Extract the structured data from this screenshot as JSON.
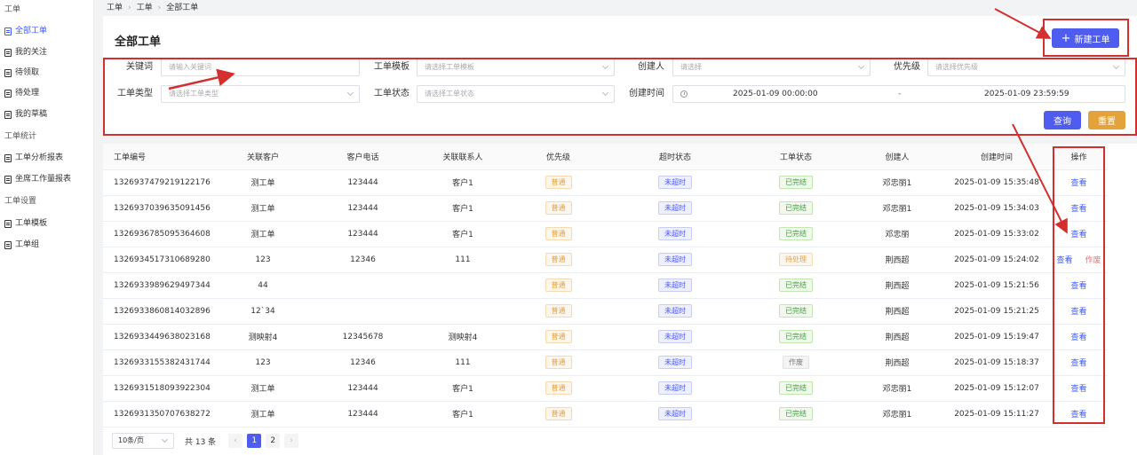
{
  "sidebar": {
    "group1": "工单",
    "items1": [
      "全部工单",
      "我的关注",
      "待领取",
      "待处理",
      "我的草稿"
    ],
    "group2": "工单统计",
    "items2": [
      "工单分析报表",
      "坐席工作量报表"
    ],
    "group3": "工单设置",
    "items3": [
      "工单模板",
      "工单组"
    ]
  },
  "breadcrumb": [
    "工单",
    "工单",
    "全部工单"
  ],
  "header": {
    "title": "全部工单",
    "new_button": "新建工单"
  },
  "filters": {
    "keyword_label": "关键词",
    "keyword_placeholder": "请输入关键词",
    "template_label": "工单模板",
    "template_placeholder": "请选择工单模板",
    "creator_label": "创建人",
    "creator_placeholder": "请选择",
    "priority_label": "优先级",
    "priority_placeholder": "请选择优先级",
    "type_label": "工单类型",
    "type_placeholder": "请选择工单类型",
    "status_label": "工单状态",
    "status_placeholder": "请选择工单状态",
    "created_label": "创建时间",
    "date_start": "2025-01-09 00:00:00",
    "date_sep": "-",
    "date_end": "2025-01-09 23:59:59",
    "query_button": "查询",
    "reset_button": "重置"
  },
  "table": {
    "headers": [
      "工单编号",
      "关联客户",
      "客户电话",
      "关联联系人",
      "优先级",
      "超时状态",
      "工单状态",
      "创建人",
      "创建时间",
      "操作"
    ],
    "rows": [
      {
        "id": "1326937479219122176",
        "customer": "测工单",
        "phone": "123444",
        "contact": "客户1",
        "priority": "普通",
        "timeout": "未超时",
        "status": "已完结",
        "creator": "邓忠丽1",
        "time": "2025-01-09 15:35:48",
        "action": "查看",
        "action2": ""
      },
      {
        "id": "1326937039635091456",
        "customer": "测工单",
        "phone": "123444",
        "contact": "客户1",
        "priority": "普通",
        "timeout": "未超时",
        "status": "已完结",
        "creator": "邓忠丽1",
        "time": "2025-01-09 15:34:03",
        "action": "查看",
        "action2": ""
      },
      {
        "id": "1326936785095364608",
        "customer": "测工单",
        "phone": "123444",
        "contact": "客户1",
        "priority": "普通",
        "timeout": "未超时",
        "status": "已完结",
        "creator": "邓忠丽",
        "time": "2025-01-09 15:33:02",
        "action": "查看",
        "action2": ""
      },
      {
        "id": "1326934517310689280",
        "customer": "123",
        "phone": "12346",
        "contact": "111",
        "priority": "普通",
        "timeout": "未超时",
        "status": "待处理",
        "creator": "荆西超",
        "time": "2025-01-09 15:24:02",
        "action": "查看",
        "action2": "作废"
      },
      {
        "id": "1326933989629497344",
        "customer": "44",
        "phone": "",
        "contact": "",
        "priority": "普通",
        "timeout": "未超时",
        "status": "已完结",
        "creator": "荆西超",
        "time": "2025-01-09 15:21:56",
        "action": "查看",
        "action2": ""
      },
      {
        "id": "1326933860814032896",
        "customer": "12`34",
        "phone": "",
        "contact": "",
        "priority": "普通",
        "timeout": "未超时",
        "status": "已完结",
        "creator": "荆西超",
        "time": "2025-01-09 15:21:25",
        "action": "查看",
        "action2": ""
      },
      {
        "id": "1326933449638023168",
        "customer": "测映射4",
        "phone": "12345678",
        "contact": "测映射4",
        "priority": "普通",
        "timeout": "未超时",
        "status": "已完结",
        "creator": "荆西超",
        "time": "2025-01-09 15:19:47",
        "action": "查看",
        "action2": ""
      },
      {
        "id": "1326933155382431744",
        "customer": "123",
        "phone": "12346",
        "contact": "111",
        "priority": "普通",
        "timeout": "未超时",
        "status": "作废",
        "creator": "荆西超",
        "time": "2025-01-09 15:18:37",
        "action": "查看",
        "action2": ""
      },
      {
        "id": "1326931518093922304",
        "customer": "测工单",
        "phone": "123444",
        "contact": "客户1",
        "priority": "普通",
        "timeout": "未超时",
        "status": "已完结",
        "creator": "邓忠丽1",
        "time": "2025-01-09 15:12:07",
        "action": "查看",
        "action2": ""
      },
      {
        "id": "1326931350707638272",
        "customer": "测工单",
        "phone": "123444",
        "contact": "客户1",
        "priority": "普通",
        "timeout": "未超时",
        "status": "已完结",
        "creator": "邓忠丽1",
        "time": "2025-01-09 15:11:27",
        "action": "查看",
        "action2": ""
      }
    ]
  },
  "pager": {
    "page_size": "10条/页",
    "total": "共 13 条",
    "pages": [
      "1",
      "2"
    ],
    "prev": "‹",
    "next": "›"
  },
  "colors": {
    "primary": "#4f5cf0",
    "reset": "#e3a23a",
    "annotation": "#d32f2f"
  }
}
